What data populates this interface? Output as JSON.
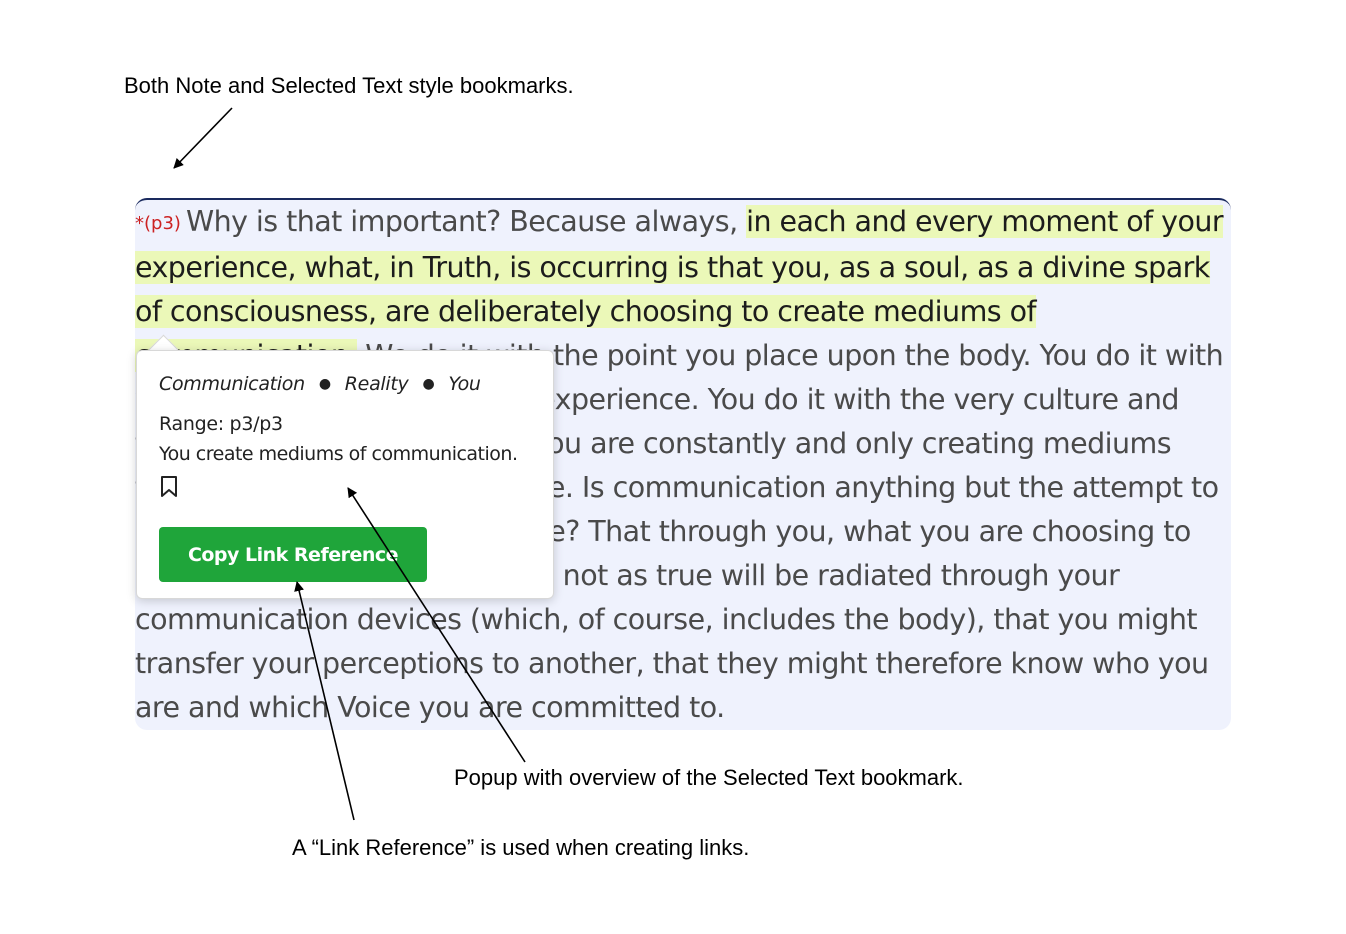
{
  "annotations": {
    "top": "Both Note and Selected Text style bookmarks.",
    "popup": "Popup with overview of the Selected Text bookmark.",
    "link_reference": "A “Link Reference” is used when creating links."
  },
  "paragraph": {
    "marker": "*(p3)",
    "text_before": "Why is that important? Because always, ",
    "highlight": "in each and every moment of your experience, what, in Truth, is occurring is that you, as a soul, as a divine spark of consciousness, are deliberately choosing to create mediums of communication.",
    "text_after": " We do it with the point you place upon the body. You do it with your very thought and every experience. You do it with the very culture and time frame that you choose. You are constantly and only creating mediums through which to communicate. Is communication anything but the attempt to rest in the Truth of who you are? That through you, what you are choosing to accept as true and to reject as not as true will be radiated through your communication devices (which, of course, includes the body), that you might transfer your perceptions to another, that they might therefore know who you are and which Voice you are committed to."
  },
  "popup": {
    "tags": [
      "Communication",
      "Reality",
      "You"
    ],
    "range": "Range: p3/p3",
    "note": "You create mediums of communication.",
    "bookmark_icon": "bookmark-icon",
    "copy_button": "Copy Link Reference"
  },
  "colors": {
    "highlight": "#ebf8b8",
    "paragraph_bg": "#eff2fd",
    "button": "#1fa53a",
    "marker": "#cc2222"
  }
}
